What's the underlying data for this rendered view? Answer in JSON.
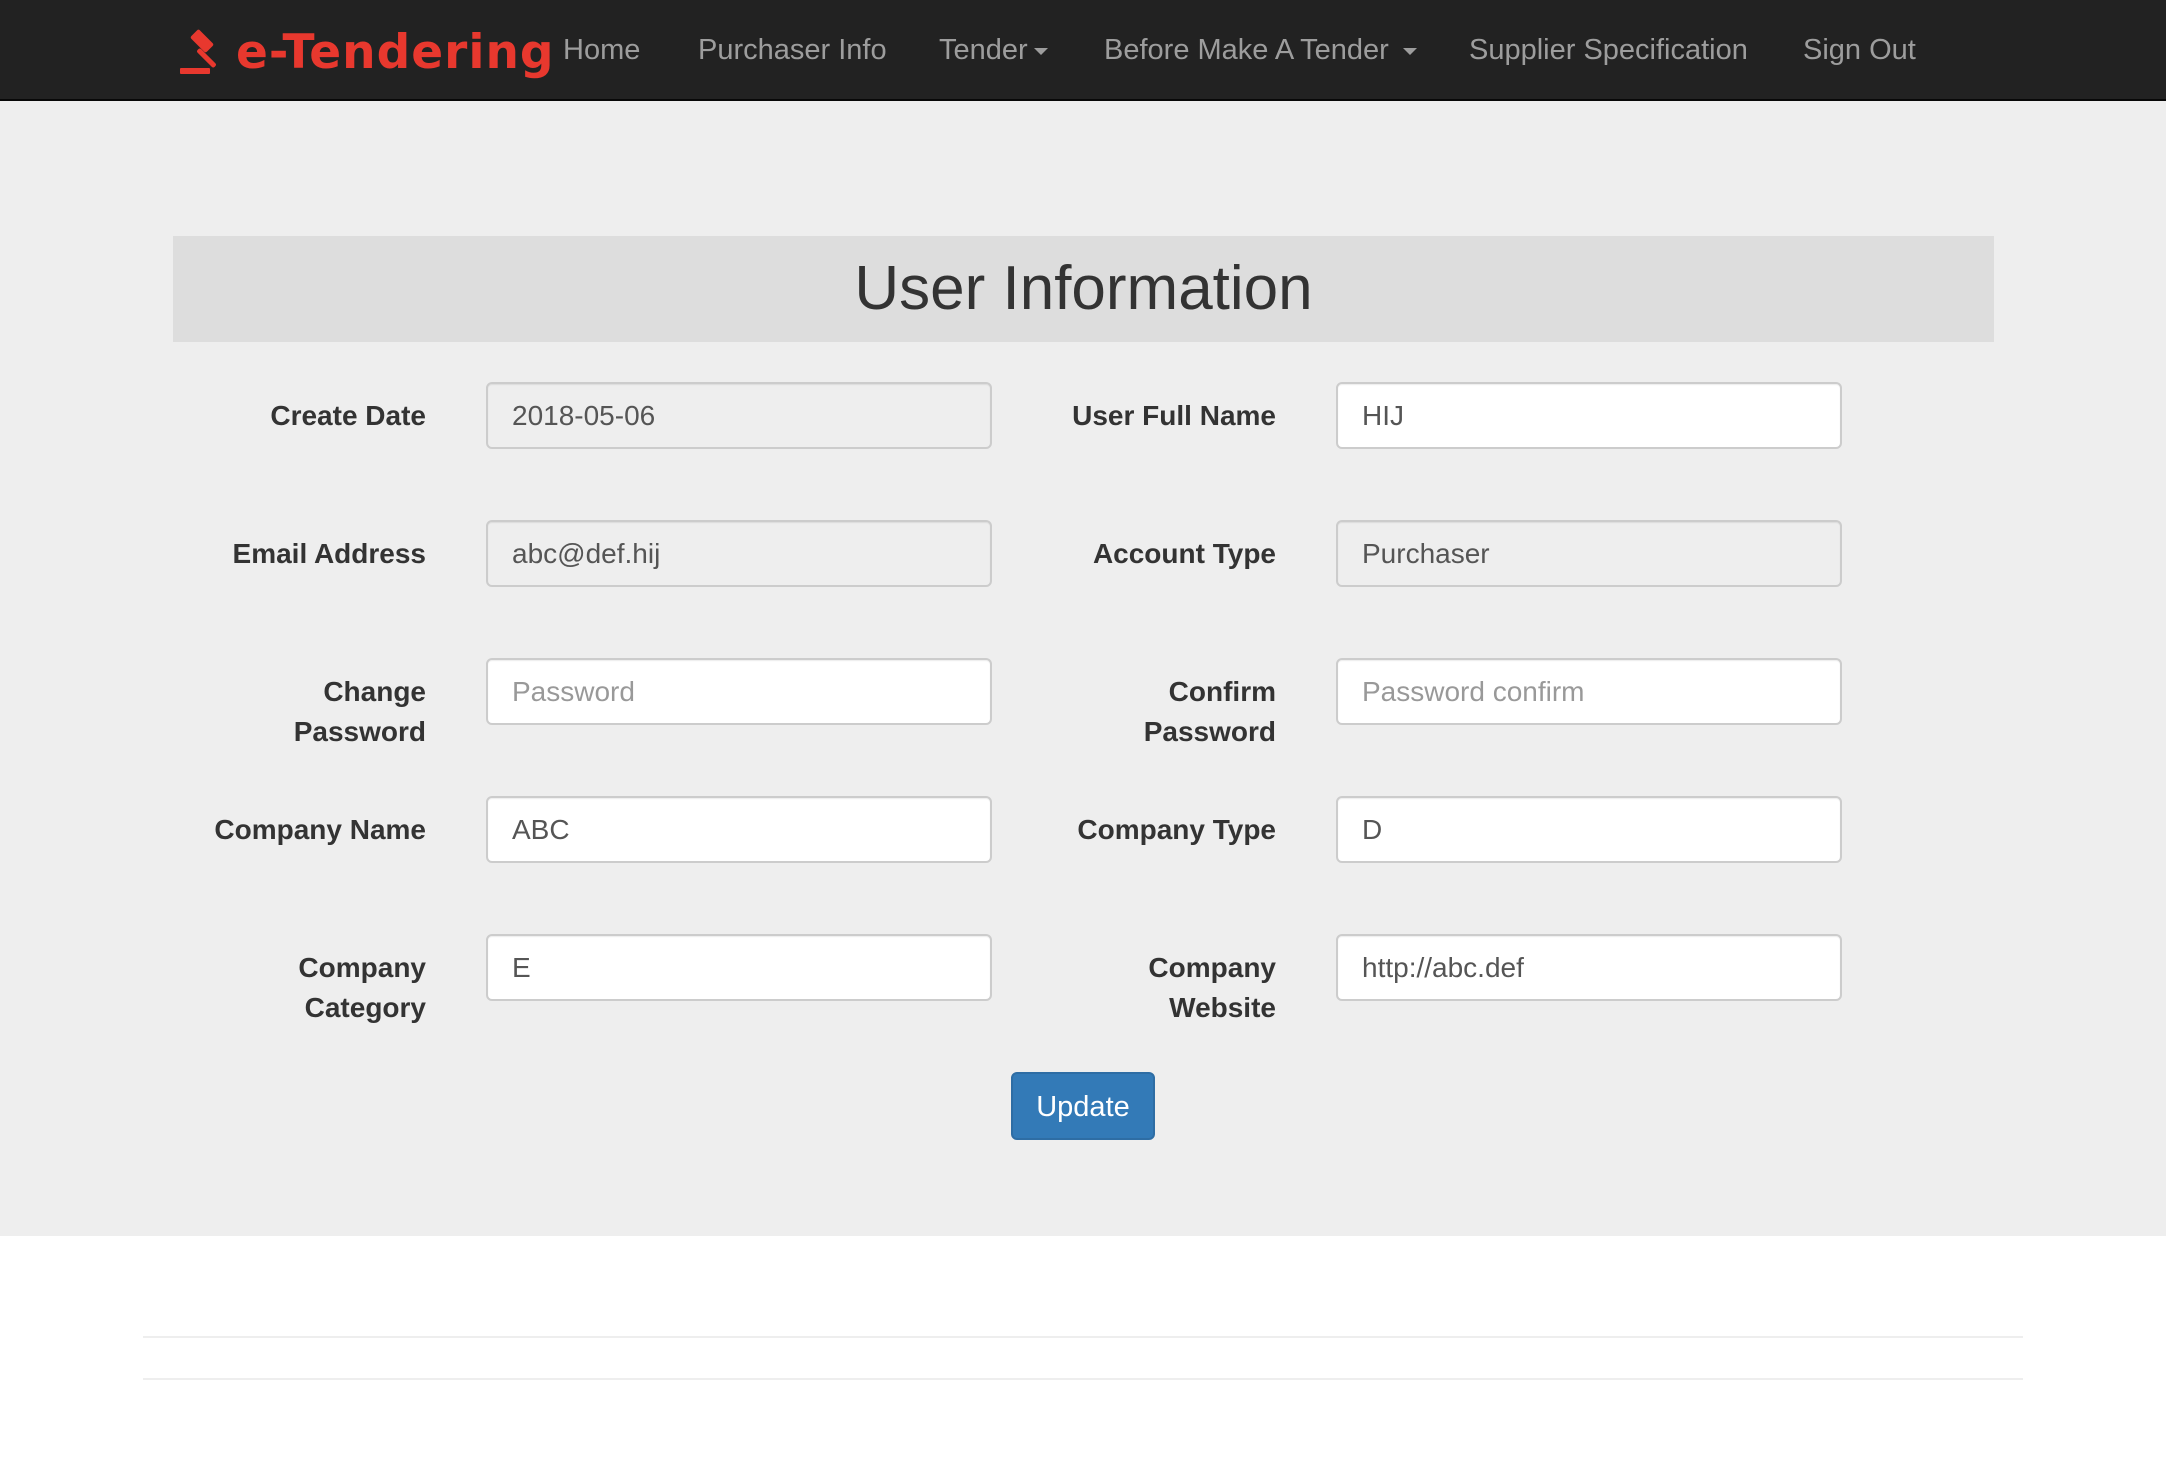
{
  "app": {
    "brand": "e-Tendering",
    "brand_color": "#e8382e"
  },
  "nav": {
    "home": "Home",
    "purchaser_info": "Purchaser Info",
    "tender": "Tender",
    "before_make_a_tender": "Before Make A Tender",
    "supplier_specification": "Supplier Specification",
    "sign_out": "Sign Out"
  },
  "page": {
    "title": "User Information"
  },
  "form": {
    "create_date": {
      "label": "Create Date",
      "value": "2018-05-06"
    },
    "user_full_name": {
      "label": "User Full Name",
      "value": "HIJ"
    },
    "email_address": {
      "label": "Email Address",
      "value": "abc@def.hij"
    },
    "account_type": {
      "label": "Account Type",
      "value": "Purchaser"
    },
    "change_password": {
      "label_line1": "Change",
      "label_line2": "Password",
      "value": "",
      "placeholder": "Password"
    },
    "confirm_password": {
      "label_line1": "Confirm",
      "label_line2": "Password",
      "value": "",
      "placeholder": "Password confirm"
    },
    "company_name": {
      "label": "Company Name",
      "value": "ABC"
    },
    "company_type": {
      "label": "Company Type",
      "value": "D"
    },
    "company_category": {
      "label_line1": "Company",
      "label_line2": "Category",
      "value": "E"
    },
    "company_website": {
      "label_line1": "Company",
      "label_line2": "Website",
      "value": "http://abc.def"
    },
    "update_label": "Update"
  },
  "colors": {
    "navbar_bg": "#222222",
    "nav_text": "#9d9d9d",
    "panel_bg": "#eeeeee",
    "title_bar_bg": "#dddddd",
    "primary_button": "#337ab7"
  },
  "icons": {
    "brand_icon": "gavel-icon",
    "dropdown_icon": "caret-down-icon"
  }
}
